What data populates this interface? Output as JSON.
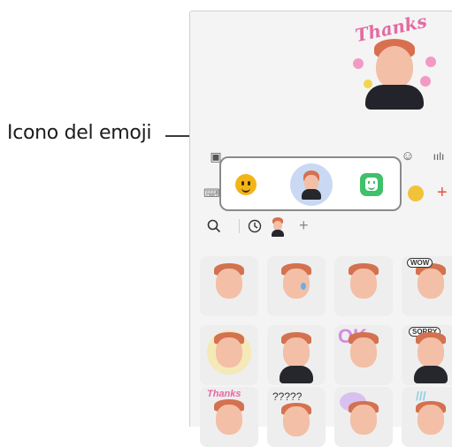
{
  "callout": {
    "label": "Icono del emoji"
  },
  "sticker_bubble": {
    "text": "Thanks"
  },
  "input_row": {
    "icons": [
      "image-icon",
      "gif-icon",
      "microphone-icon",
      "emoji-icon",
      "voice-icon"
    ]
  },
  "emoji_popup": {
    "options": [
      "emoji-icon",
      "ar-emoji-icon",
      "bitmoji-icon"
    ],
    "selected": "ar-emoji-icon"
  },
  "toolbar": {
    "plus_label": "+"
  },
  "filter_row": {
    "search": "Q",
    "recent": "◷",
    "add": "+"
  },
  "stickers": [
    {
      "text": ""
    },
    {
      "text": ""
    },
    {
      "text": ""
    },
    {
      "text": "WOW"
    },
    {
      "text": ""
    },
    {
      "text": ""
    },
    {
      "text": "OK"
    },
    {
      "text": "SORRY"
    },
    {
      "text": "Thanks"
    },
    {
      "text": "?????"
    },
    {
      "text": ""
    },
    {
      "text": "///"
    }
  ],
  "colors": {
    "accent": "#e0563c",
    "selected_bg": "#c9d9f3",
    "emoji_yellow": "#f2b519",
    "bitmoji_green": "#3fc06b"
  }
}
